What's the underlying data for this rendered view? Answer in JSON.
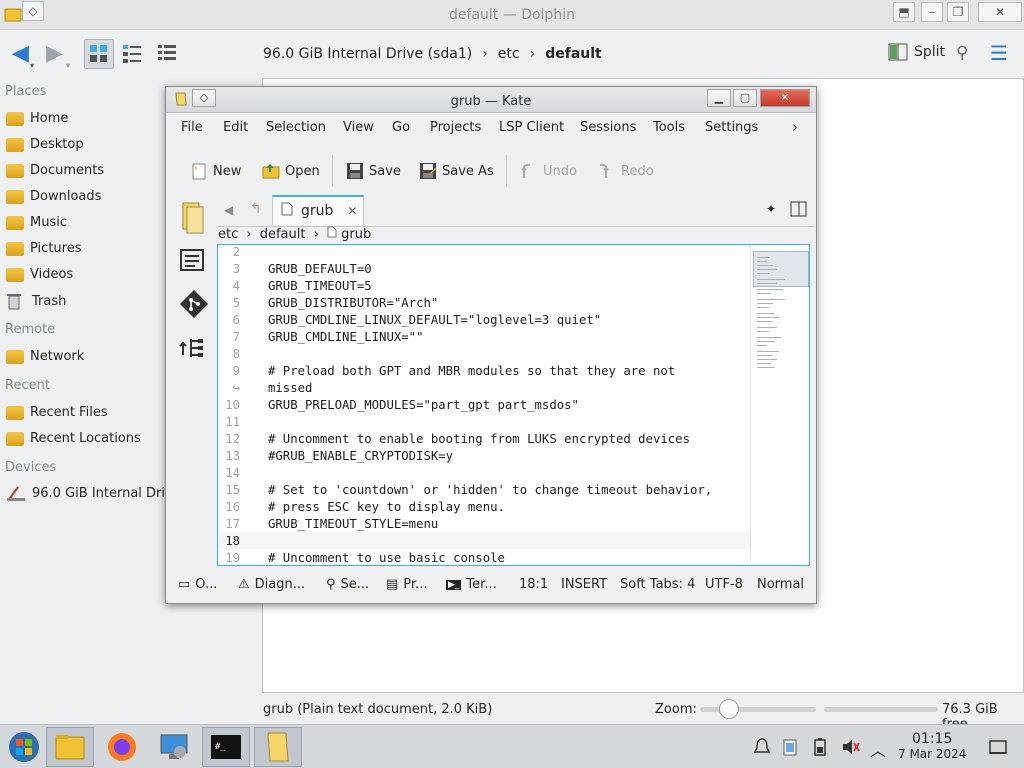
{
  "dolphin": {
    "title": "default — Dolphin",
    "breadcrumb": [
      "96.0 GiB Internal Drive (sda1)",
      "etc",
      "default"
    ],
    "split_label": "Split",
    "places": {
      "places_header": "Places",
      "places_items": [
        "Home",
        "Desktop",
        "Documents",
        "Downloads",
        "Music",
        "Pictures",
        "Videos",
        "Trash"
      ],
      "remote_header": "Remote",
      "remote_items": [
        "Network"
      ],
      "recent_header": "Recent",
      "recent_items": [
        "Recent Files",
        "Recent Locations"
      ],
      "devices_header": "Devices",
      "device_items": [
        "96.0 GiB Internal Drive"
      ]
    },
    "status_text": "grub (Plain text document, 2.0 KiB)",
    "zoom_label": "Zoom:",
    "zoom_level": 0.25,
    "free_space": "76.3 GiB free"
  },
  "kate": {
    "title": "grub — Kate",
    "menu": [
      "File",
      "Edit",
      "Selection",
      "View",
      "Go",
      "Projects",
      "LSP Client",
      "Sessions",
      "Tools",
      "Settings"
    ],
    "toolbar": {
      "new": "New",
      "open": "Open",
      "save": "Save",
      "save_as": "Save As",
      "undo": "Undo",
      "redo": "Redo"
    },
    "tab_label": "grub",
    "path": [
      "etc",
      "default",
      "grub"
    ],
    "lines": [
      {
        "n": "2",
        "text": ""
      },
      {
        "n": "3",
        "text": "GRUB_DEFAULT=0"
      },
      {
        "n": "4",
        "text": "GRUB_TIMEOUT=5"
      },
      {
        "n": "5",
        "text": "GRUB_DISTRIBUTOR=\"Arch\""
      },
      {
        "n": "6",
        "text": "GRUB_CMDLINE_LINUX_DEFAULT=\"loglevel=3 quiet\""
      },
      {
        "n": "7",
        "text": "GRUB_CMDLINE_LINUX=\"\""
      },
      {
        "n": "8",
        "text": ""
      },
      {
        "n": "9",
        "text": "# Preload both GPT and MBR modules so that they are not"
      },
      {
        "n": "↪",
        "text": "missed"
      },
      {
        "n": "10",
        "text": "GRUB_PRELOAD_MODULES=\"part_gpt part_msdos\""
      },
      {
        "n": "11",
        "text": ""
      },
      {
        "n": "12",
        "text": "# Uncomment to enable booting from LUKS encrypted devices"
      },
      {
        "n": "13",
        "text": "#GRUB_ENABLE_CRYPTODISK=y"
      },
      {
        "n": "14",
        "text": ""
      },
      {
        "n": "15",
        "text": "# Set to 'countdown' or 'hidden' to change timeout behavior,"
      },
      {
        "n": "16",
        "text": "# press ESC key to display menu."
      },
      {
        "n": "17",
        "text": "GRUB_TIMEOUT_STYLE=menu"
      },
      {
        "n": "18",
        "text": ""
      },
      {
        "n": "19",
        "text": "# Uncomment to use basic console"
      }
    ],
    "statusbar": {
      "output": "O...",
      "diagnostics": "Diagn...",
      "search": "Se...",
      "projects": "Pr...",
      "terminal": "Ter...",
      "cursor": "18:1",
      "mode": "INSERT",
      "indent": "Soft Tabs: 4",
      "encoding": "UTF-8",
      "syntax": "Normal"
    }
  },
  "taskbar": {
    "time": "01:15",
    "date": "7 Mar 2024"
  }
}
